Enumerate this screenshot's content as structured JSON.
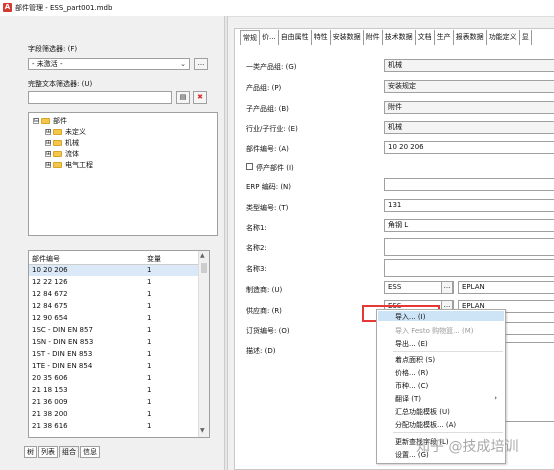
{
  "window": {
    "title": "部件管理 - ESS_part001.mdb"
  },
  "left": {
    "field_filter_label": "字段筛选器: (F)",
    "field_filter_value": "- 未激活 -",
    "fulltext_filter_label": "完整文本筛选器: (U)",
    "fulltext_value": "",
    "tree": [
      {
        "label": "部件",
        "expander": "⊟",
        "level": 0
      },
      {
        "label": "未定义",
        "expander": "⊞",
        "level": 1
      },
      {
        "label": "机械",
        "expander": "⊞",
        "level": 1
      },
      {
        "label": "流体",
        "expander": "⊞",
        "level": 1
      },
      {
        "label": "电气工程",
        "expander": "⊞",
        "level": 1
      }
    ],
    "table": {
      "headers": [
        "部件编号",
        "变量"
      ],
      "rows": [
        [
          "10 20 206",
          "1"
        ],
        [
          "12 22 126",
          "1"
        ],
        [
          "12 84 672",
          "1"
        ],
        [
          "12 84 675",
          "1"
        ],
        [
          "12 90 654",
          "1"
        ],
        [
          "1SC - DIN EN 857",
          "1"
        ],
        [
          "1SN - DIN EN 853",
          "1"
        ],
        [
          "1ST - DIN EN 853",
          "1"
        ],
        [
          "1TE - DIN EN 854",
          "1"
        ],
        [
          "20 35 606",
          "1"
        ],
        [
          "21 18 153",
          "1"
        ],
        [
          "21 36 009",
          "1"
        ],
        [
          "21 38 200",
          "1"
        ],
        [
          "21 38 616",
          "1"
        ]
      ]
    },
    "bottom_tabs": [
      "树",
      "列表",
      "组合",
      "信息"
    ]
  },
  "right": {
    "tabs": [
      "常规",
      "价...",
      "自由属性",
      "特性",
      "安装数据",
      "附件",
      "技术数据",
      "文档",
      "生产",
      "报表数据",
      "功能定义",
      "显"
    ],
    "fields": [
      {
        "label": "一类产品组: (G)",
        "value": "机械"
      },
      {
        "label": "产品组: (P)",
        "value": "安装规定"
      },
      {
        "label": "子产品组: (B)",
        "value": "附件"
      },
      {
        "label": "行业/子行业: (E)",
        "value": "机械"
      },
      {
        "label": "部件编号: (A)",
        "value": "10 20 206"
      }
    ],
    "discontinued_label": "停产部件 (I)",
    "fields2": [
      {
        "label": "ERP 编码: (N)",
        "value": ""
      },
      {
        "label": "类型编号: (T)",
        "value": "131"
      },
      {
        "label": "名称1:",
        "value": "角钢 L"
      },
      {
        "label": "名称2:",
        "value": ""
      },
      {
        "label": "名称3:",
        "value": ""
      }
    ],
    "manufacturer_label": "制造商: (U)",
    "manufacturer_value": "ESS",
    "manufacturer_name": "EPLAN",
    "supplier_label": "供应商: (R)",
    "supplier_value": "ESS",
    "supplier_name": "EPLAN",
    "order_label": "订货编号: (O)",
    "desc_label": "描述: (D)"
  },
  "context_menu": {
    "items": [
      {
        "label": "导入... (I)",
        "disabled": false,
        "highlight": true
      },
      {
        "label": "导入 Festo 购物篮... (M)",
        "disabled": true
      },
      {
        "label": "导出... (E)",
        "disabled": false
      },
      {
        "label": "sep"
      },
      {
        "label": "着点面积 (S)",
        "disabled": false
      },
      {
        "label": "价格... (R)",
        "disabled": false
      },
      {
        "label": "币种... (C)",
        "disabled": false
      },
      {
        "label": "翻译 (T)",
        "disabled": false,
        "submenu": true
      },
      {
        "label": "汇总功能模板 (U)",
        "disabled": false
      },
      {
        "label": "分配功能模板... (A)",
        "disabled": false
      },
      {
        "label": "sep"
      },
      {
        "label": "更新查找字段 (L)",
        "disabled": false
      },
      {
        "label": "设置... (G)",
        "disabled": false
      }
    ],
    "submenu_arrow": "›"
  },
  "watermark": "知乎 @技成培训",
  "colors": {
    "accent": "#e53935",
    "selection": "#dbe8f8",
    "menu_hover": "#cde4f7"
  }
}
